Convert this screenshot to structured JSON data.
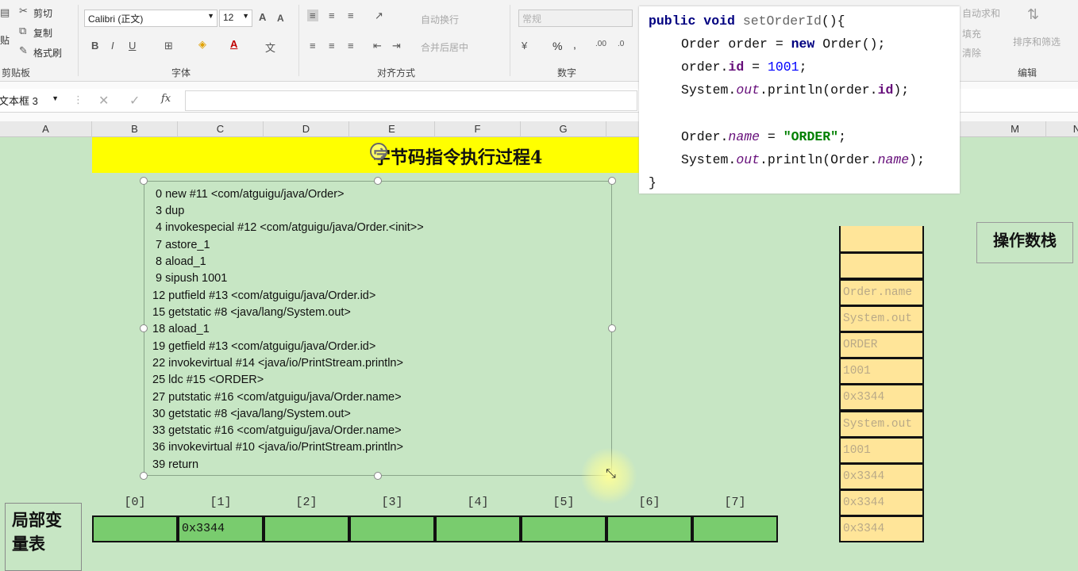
{
  "ribbon": {
    "clipboard": {
      "cut": "剪切",
      "copy": "复制",
      "format_painter": "格式刷",
      "paste_partial": "贴",
      "group": "剪贴板"
    },
    "font": {
      "name": "Calibri (正文)",
      "size": "12",
      "group": "字体"
    },
    "alignment": {
      "wrap": "自动换行",
      "merge": "合并后居中",
      "group": "对齐方式"
    },
    "number": {
      "format": "常规",
      "percent": "%",
      "comma": ",",
      "group": "数字"
    },
    "editing": {
      "autosum": "自动求和",
      "fill": "填充",
      "clear": "清除",
      "sort_filter": "排序和筛选",
      "group": "编辑"
    }
  },
  "formula_bar": {
    "name_box": "文本框 3",
    "fx": "fx"
  },
  "columns": [
    "A",
    "B",
    "C",
    "D",
    "E",
    "F",
    "G",
    "M",
    "N"
  ],
  "sheet_title": "字节码指令执行过程4",
  "bytecode": [
    "0 new #11 <com/atguigu/java/Order>",
    "3 dup",
    "4 invokespecial #12 <com/atguigu/java/Order.<init>>",
    "7 astore_1",
    "8 aload_1",
    "9 sipush 1001",
    "12 putfield #13 <com/atguigu/java/Order.id>",
    "15 getstatic #8 <java/lang/System.out>",
    "18 aload_1",
    "19 getfield #13 <com/atguigu/java/Order.id>",
    "22 invokevirtual #14 <java/io/PrintStream.println>",
    "25 ldc #15 <ORDER>",
    "27 putstatic #16 <com/atguigu/java/Order.name>",
    "30 getstatic #8 <java/lang/System.out>",
    "33 getstatic #16 <com/atguigu/java/Order.name>",
    "36 invokevirtual #10 <java/io/PrintStream.println>",
    "39 return"
  ],
  "code": {
    "l1_kw": "public void",
    "l1_fn": "setOrderId",
    "l1_rest": "(){",
    "l2_type": "Order order = ",
    "l2_kw": "new",
    "l2_rest": " Order();",
    "l3_a": "order.",
    "l3_fld": "id",
    "l3_eq": " = ",
    "l3_num": "1001",
    "l3_end": ";",
    "l4_a": "System.",
    "l4_out": "out",
    "l4_b": ".println(order.",
    "l4_fld": "id",
    "l4_end": ");",
    "l5_a": "Order.",
    "l5_name": "name",
    "l5_eq": " = ",
    "l5_str": "\"ORDER\"",
    "l5_end": ";",
    "l6_a": "System.",
    "l6_out": "out",
    "l6_b": ".println(Order.",
    "l6_name": "name",
    "l6_end": ");",
    "l7": "}"
  },
  "operand_stack": {
    "label": "操作数栈",
    "cells": [
      "",
      "",
      "Order.name",
      "System.out",
      "ORDER",
      "1001",
      "0x3344",
      "System.out",
      "1001",
      "0x3344",
      "0x3344",
      "0x3344"
    ]
  },
  "local_vars": {
    "label_line1": "局部变",
    "label_line2": "量表",
    "indices": [
      "[0]",
      "[1]",
      "[2]",
      "[3]",
      "[4]",
      "[5]",
      "[6]",
      "[7]"
    ],
    "values": [
      "",
      "0x3344",
      "",
      "",
      "",
      "",
      "",
      ""
    ]
  }
}
